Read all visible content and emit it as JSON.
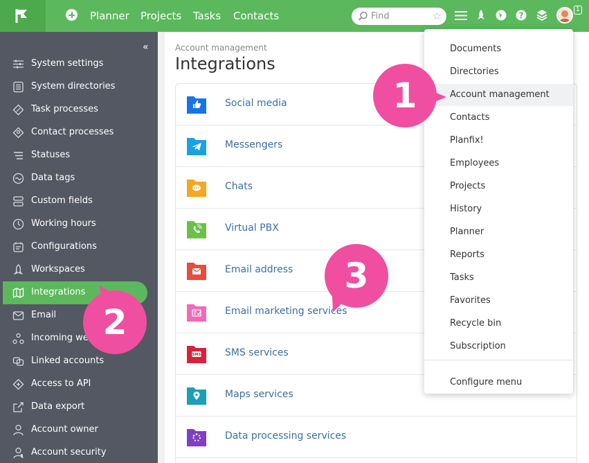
{
  "topbar": {
    "nav": [
      {
        "label": "Planner",
        "icon": "plus-circle-icon"
      },
      {
        "label": "Projects"
      },
      {
        "label": "Tasks"
      },
      {
        "label": "Contacts"
      }
    ],
    "search_placeholder": "Find",
    "notification_count": "1",
    "brand_color": "#5cb85c"
  },
  "sidebar": {
    "items": [
      {
        "label": "System settings",
        "icon": "sliders-icon"
      },
      {
        "label": "System directories",
        "icon": "directory-icon"
      },
      {
        "label": "Task processes",
        "icon": "diamond-icon"
      },
      {
        "label": "Contact processes",
        "icon": "contact-process-icon"
      },
      {
        "label": "Statuses",
        "icon": "statuses-icon"
      },
      {
        "label": "Data tags",
        "icon": "tag-icon"
      },
      {
        "label": "Custom fields",
        "icon": "fields-icon"
      },
      {
        "label": "Working hours",
        "icon": "clock-icon"
      },
      {
        "label": "Configurations",
        "icon": "config-icon"
      },
      {
        "label": "Workspaces",
        "icon": "rocket-icon"
      },
      {
        "label": "Integrations",
        "icon": "map-icon",
        "active": true
      },
      {
        "label": "Email",
        "icon": "email-icon"
      },
      {
        "label": "Incoming webh",
        "icon": "webhook-icon"
      },
      {
        "label": "Linked accounts",
        "icon": "link-icon"
      },
      {
        "label": "Access to API",
        "icon": "api-icon"
      },
      {
        "label": "Data export",
        "icon": "export-icon"
      },
      {
        "label": "Account owner",
        "icon": "user-icon"
      },
      {
        "label": "Account security",
        "icon": "shield-icon"
      }
    ]
  },
  "main": {
    "breadcrumb": "Account management",
    "title": "Integrations",
    "rows": [
      {
        "label": "Social media",
        "color": "#1a73e8",
        "icon": "thumbs-up-icon"
      },
      {
        "label": "Messengers",
        "color": "#1aa1e0",
        "icon": "telegram-icon"
      },
      {
        "label": "Chats",
        "color": "#f5a623",
        "icon": "chat-icon"
      },
      {
        "label": "Virtual PBX",
        "color": "#6cc04a",
        "icon": "phone-icon"
      },
      {
        "label": "Email address",
        "color": "#e74c3c",
        "icon": "envelope-icon"
      },
      {
        "label": "Email marketing services",
        "color": "#f06ab7",
        "icon": "newsletter-icon"
      },
      {
        "label": "SMS services",
        "color": "#d9213a",
        "icon": "sms-icon"
      },
      {
        "label": "Maps services",
        "color": "#1b9fb5",
        "icon": "map-pin-icon"
      },
      {
        "label": "Data processing services",
        "color": "#7e3fc4",
        "icon": "spinner-icon"
      }
    ]
  },
  "menu": {
    "items": [
      {
        "label": "Documents"
      },
      {
        "label": "Directories"
      },
      {
        "label": "Account management",
        "highlight": true
      },
      {
        "label": "Contacts"
      },
      {
        "label": "Planfix!"
      },
      {
        "label": "Employees"
      },
      {
        "label": "Projects"
      },
      {
        "label": "History"
      },
      {
        "label": "Planner"
      },
      {
        "label": "Reports"
      },
      {
        "label": "Tasks"
      },
      {
        "label": "Favorites"
      },
      {
        "label": "Recycle bin"
      },
      {
        "label": "Subscription"
      }
    ],
    "configure_label": "Configure menu"
  },
  "callouts": [
    "1",
    "2",
    "3"
  ],
  "callout_color": "#f04ea1"
}
